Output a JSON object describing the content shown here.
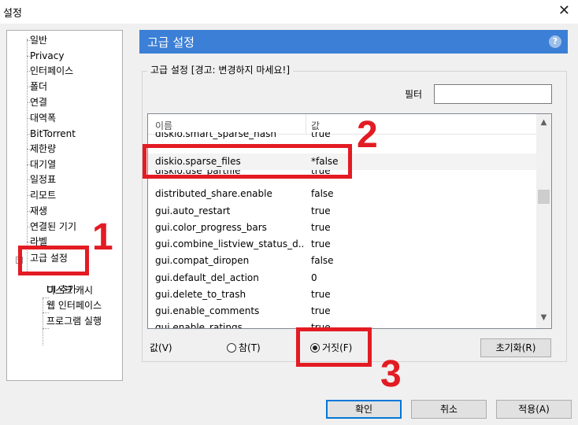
{
  "window": {
    "title": "설정",
    "close": "✕"
  },
  "tree": {
    "items": [
      "일반",
      "Privacy",
      "인터페이스",
      "폴더",
      "연결",
      "대역폭",
      "BitTorrent",
      "제한량",
      "대기열",
      "일정표",
      "리모트",
      "재생",
      "연결된 기기",
      "라벨",
      "고급 설정",
      "디스크 캐시",
      "웹 인터페이스",
      "프로그램 실행"
    ],
    "expander": "−"
  },
  "panel": {
    "header": "고급 설정",
    "help": "?",
    "group_title": "고급 설정 [경고: 변경하지 마세요!]",
    "filter_label": "필터",
    "filter_value": ""
  },
  "list": {
    "col_name": "이름",
    "col_value": "값",
    "rows": [
      {
        "name": "diskio.smart_sparse_hash",
        "value": "true"
      },
      {
        "name": "diskio.sparse_files",
        "value": "*false"
      },
      {
        "name": "diskio.use_partfile",
        "value": "true"
      },
      {
        "name": "distributed_share.enable",
        "value": "false"
      },
      {
        "name": "gui.auto_restart",
        "value": "true"
      },
      {
        "name": "gui.color_progress_bars",
        "value": "true"
      },
      {
        "name": "gui.combine_listview_status_d...",
        "value": "true"
      },
      {
        "name": "gui.compat_diropen",
        "value": "false"
      },
      {
        "name": "gui.default_del_action",
        "value": "0"
      },
      {
        "name": "gui.delete_to_trash",
        "value": "true"
      },
      {
        "name": "gui.enable_comments",
        "value": "true"
      },
      {
        "name": "gui.enable_ratings",
        "value": "true"
      }
    ]
  },
  "value_section": {
    "label": "값(V)",
    "true_label": "참(T)",
    "false_label": "거짓(F)",
    "selected": "false",
    "reset": "초기화(R)"
  },
  "buttons": {
    "ok": "확인",
    "cancel": "취소",
    "apply": "적용(A)"
  },
  "annotations": {
    "one": "1",
    "two": "2",
    "three": "3",
    "color": "#e31b23"
  }
}
